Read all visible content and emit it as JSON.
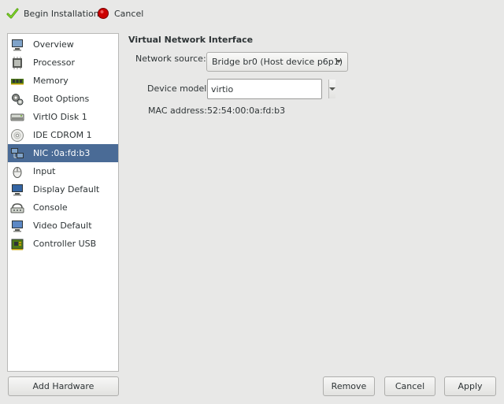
{
  "toolbar": {
    "begin_label": "Begin Installation",
    "cancel_label": "Cancel"
  },
  "sidebar": {
    "items": [
      {
        "label": "Overview",
        "icon": "monitor-icon"
      },
      {
        "label": "Processor",
        "icon": "cpu-icon"
      },
      {
        "label": "Memory",
        "icon": "memory-icon"
      },
      {
        "label": "Boot Options",
        "icon": "gears-icon"
      },
      {
        "label": "VirtIO Disk 1",
        "icon": "harddisk-icon"
      },
      {
        "label": "IDE CDROM 1",
        "icon": "cdrom-icon"
      },
      {
        "label": "NIC :0a:fd:b3",
        "icon": "network-icon"
      },
      {
        "label": "Input",
        "icon": "mouse-icon"
      },
      {
        "label": "Display Default",
        "icon": "display-icon"
      },
      {
        "label": "Console",
        "icon": "serial-icon"
      },
      {
        "label": "Video Default",
        "icon": "video-icon"
      },
      {
        "label": "Controller USB",
        "icon": "controller-icon"
      }
    ],
    "selected_index": 6
  },
  "details": {
    "title": "Virtual Network Interface",
    "network_source_label": "Network source:",
    "network_source_value": "Bridge br0 (Host device p6p1)",
    "device_model_label": "Device model:",
    "device_model_value": "virtio",
    "mac_label": "MAC address:",
    "mac_value": "52:54:00:0a:fd:b3"
  },
  "buttons": {
    "add_hardware": "Add Hardware",
    "remove": "Remove",
    "cancel": "Cancel",
    "apply": "Apply"
  },
  "colors": {
    "selection": "#4a6b96",
    "window_bg": "#e8e8e7",
    "check_green": "#73d216",
    "cancel_red": "#cc0000"
  }
}
